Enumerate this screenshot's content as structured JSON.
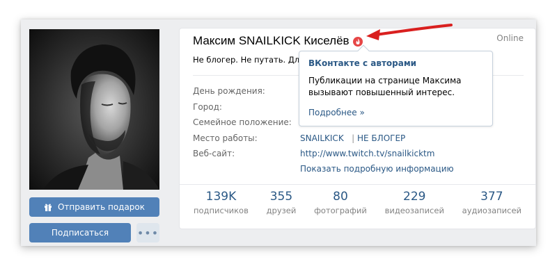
{
  "profile": {
    "name": "Максим SNAILKICK Киселёв",
    "online": "Online",
    "status": "Не блогер. Не путать. Для сотрудничества: snailkicktv@gmail.com",
    "photo_alt": "profile-photo"
  },
  "buttons": {
    "gift": "Отправить подарок",
    "subscribe": "Подписаться",
    "more": "•••"
  },
  "info": {
    "labels": [
      "День рождения:",
      "Город:",
      "Семейное положение:",
      "Место работы:",
      "Веб-сайт:"
    ],
    "work_link": "SNAILKICK",
    "work_sep": "|",
    "work_link2": "НЕ БЛОГЕР",
    "website": "http://www.twitch.tv/snailkicktm",
    "show_more": "Показать подробную информацию"
  },
  "counters": [
    {
      "num": "139K",
      "label": "подписчиков"
    },
    {
      "num": "355",
      "label": "друзей"
    },
    {
      "num": "80",
      "label": "фотографий"
    },
    {
      "num": "229",
      "label": "видеозаписей"
    },
    {
      "num": "377",
      "label": "аудиозаписей"
    }
  ],
  "popup": {
    "title": "ВКонтакте с авторами",
    "text": "Публикации на странице Максима вызывают повышенный интерес.",
    "link": "Подробнее »"
  },
  "colors": {
    "accent": "#5181b8",
    "link": "#2a5885",
    "fire": "#e64646",
    "annotation": "#d9201f"
  },
  "icons": {
    "gift": "gift-icon",
    "fire": "fire-icon",
    "arrow": "red-arrow-annotation"
  }
}
